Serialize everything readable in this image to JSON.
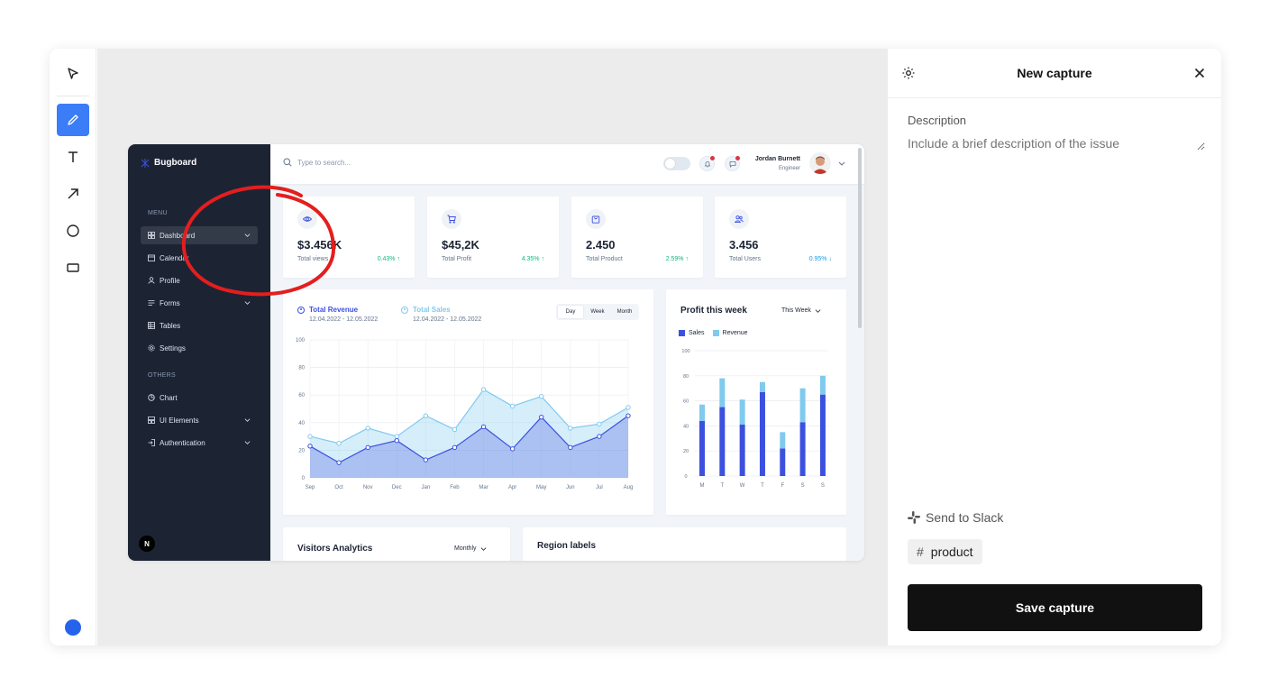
{
  "toolbar": {
    "tools": [
      "select-tool",
      "pen-tool",
      "text-tool",
      "arrow-tool",
      "circle-tool",
      "rectangle-tool"
    ],
    "active_tool": "pen-tool",
    "active_color": "#2563eb"
  },
  "panel": {
    "title": "New capture",
    "description_label": "Description",
    "description_placeholder": "Include a brief description of the issue",
    "slack_label": "Send to Slack",
    "channel_hash": "#",
    "channel": "product",
    "save_label": "Save capture"
  },
  "screenshot": {
    "brand": "Bugboard",
    "menu_section": "MENU",
    "others_section": "OTHERS",
    "nav": [
      {
        "label": "Dashboard",
        "icon": "grid-icon",
        "chevron": true,
        "active": true
      },
      {
        "label": "Calendar",
        "icon": "calendar-icon",
        "chevron": false
      },
      {
        "label": "Profile",
        "icon": "user-icon",
        "chevron": false
      },
      {
        "label": "Forms",
        "icon": "forms-icon",
        "chevron": true
      },
      {
        "label": "Tables",
        "icon": "table-icon",
        "chevron": false
      },
      {
        "label": "Settings",
        "icon": "gear-icon",
        "chevron": false
      }
    ],
    "others": [
      {
        "label": "Chart",
        "icon": "pie-icon",
        "chevron": false
      },
      {
        "label": "UI Elements",
        "icon": "layout-icon",
        "chevron": true
      },
      {
        "label": "Authentication",
        "icon": "login-icon",
        "chevron": true
      }
    ],
    "avatar_badge": "N",
    "search_placeholder": "Type to search...",
    "user_name": "Jordan Burnett",
    "user_role": "Engineer",
    "stats": [
      {
        "value": "$3.456K",
        "label": "Total views",
        "change": "0.43%",
        "trend": "up",
        "icon": "eye-icon"
      },
      {
        "value": "$45,2K",
        "label": "Total Profit",
        "change": "4.35%",
        "trend": "up",
        "icon": "cart-icon"
      },
      {
        "value": "2.450",
        "label": "Total Product",
        "change": "2.59%",
        "trend": "up",
        "icon": "bag-icon"
      },
      {
        "value": "3.456",
        "label": "Total Users",
        "change": "0.95%",
        "trend": "down",
        "icon": "users-icon"
      }
    ],
    "trend_up_glyph": "↑",
    "trend_down_glyph": "↓",
    "revenue_legend": {
      "name": "Total Revenue",
      "range": "12.04.2022 - 12.05.2022",
      "color": "#3c50e0"
    },
    "sales_legend": {
      "name": "Total Sales",
      "range": "12.04.2022 - 12.05.2022",
      "color": "#80caee"
    },
    "range_tabs": [
      "Day",
      "Week",
      "Month"
    ],
    "active_range": "Day",
    "profit_title": "Profit this week",
    "profit_filter": "This Week",
    "profit_legend": [
      "Sales",
      "Revenue"
    ],
    "visitors_title": "Visitors Analytics",
    "visitors_filter": "Monthly",
    "region_title": "Region labels"
  },
  "chart_data": [
    {
      "type": "area",
      "categories": [
        "Sep",
        "Oct",
        "Nov",
        "Dec",
        "Jan",
        "Feb",
        "Mar",
        "Apr",
        "May",
        "Jun",
        "Jul",
        "Aug"
      ],
      "series": [
        {
          "name": "Total Revenue",
          "values": [
            23,
            11,
            22,
            27,
            13,
            22,
            37,
            21,
            44,
            22,
            30,
            45
          ],
          "color": "#3c50e0"
        },
        {
          "name": "Total Sales",
          "values": [
            30,
            25,
            36,
            30,
            45,
            35,
            64,
            52,
            59,
            36,
            39,
            51
          ],
          "color": "#80caee"
        }
      ],
      "ylim": [
        0,
        100
      ],
      "yticks": [
        0,
        20,
        40,
        60,
        80,
        100
      ],
      "grid": true
    },
    {
      "type": "bar",
      "stacked": true,
      "categories": [
        "M",
        "T",
        "W",
        "T",
        "F",
        "S",
        "S"
      ],
      "series": [
        {
          "name": "Sales",
          "values": [
            44,
            55,
            41,
            67,
            22,
            43,
            65
          ],
          "color": "#3c50e0"
        },
        {
          "name": "Revenue",
          "values": [
            13,
            23,
            20,
            8,
            13,
            27,
            15
          ],
          "color": "#80caee"
        }
      ],
      "ylim": [
        0,
        100
      ],
      "yticks": [
        0,
        20,
        40,
        60,
        80,
        100
      ],
      "grid": true
    }
  ]
}
